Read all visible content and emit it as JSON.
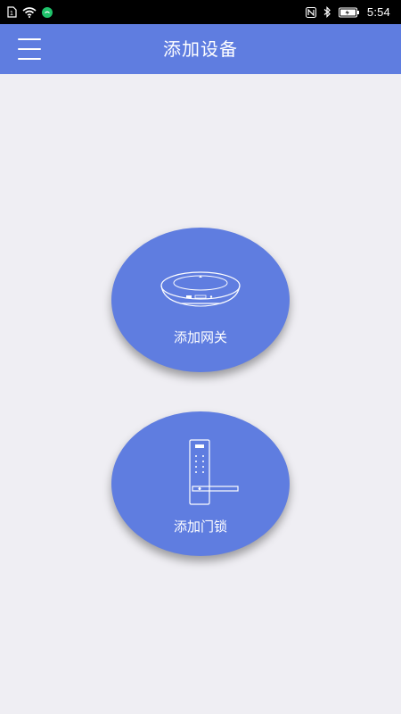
{
  "status_bar": {
    "time": "5:54",
    "icons": [
      "sim-icon",
      "wifi-icon",
      "notification-icon",
      "nfc-icon",
      "bluetooth-icon",
      "battery-icon"
    ]
  },
  "header": {
    "title": "添加设备",
    "menu_icon": "menu-icon"
  },
  "main": {
    "add_gateway_label": "添加网关",
    "add_gateway_icon": "gateway-icon",
    "add_lock_label": "添加门锁",
    "add_lock_icon": "door-lock-icon"
  },
  "colors": {
    "accent": "#5f7de0",
    "background": "#efeef3",
    "status_bar": "#000000"
  }
}
